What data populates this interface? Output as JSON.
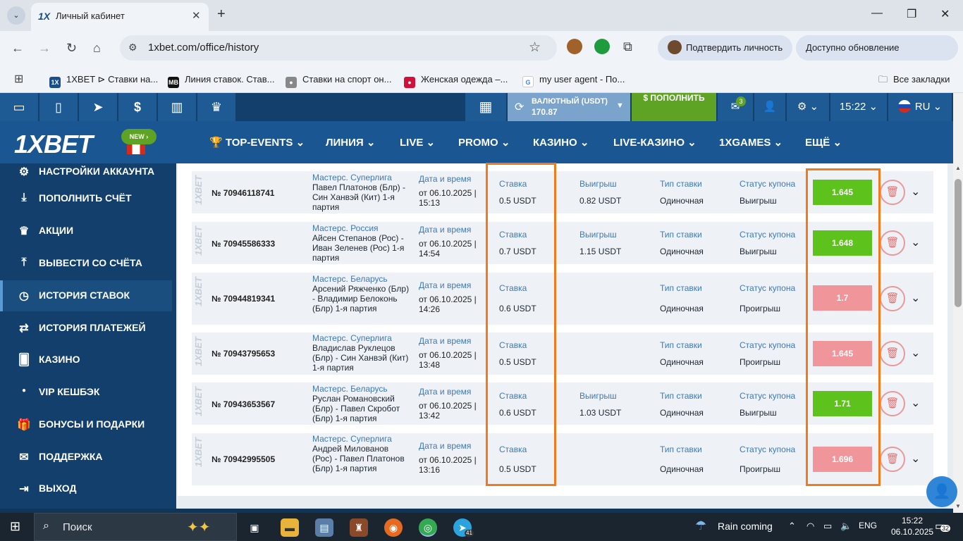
{
  "browser": {
    "tab_title": "Личный кабинет",
    "tab_favicon": "1X",
    "url": "1xbet.com/office/history",
    "profile_pill": "Подтвердить личность",
    "update_pill": "Доступно обновление Chrome",
    "bookmarks": [
      {
        "label": "1XBET ⊳ Ставки на...",
        "icon": "1X",
        "color": "#1a4f8a"
      },
      {
        "label": "Линия ставок. Став...",
        "icon": "MB",
        "color": "#111111"
      },
      {
        "label": "Ставки на спорт он...",
        "icon": "●",
        "color": "#888888"
      },
      {
        "label": "Женская одежда –...",
        "icon": "●",
        "color": "#d0103a"
      },
      {
        "label": "my user agent - По...",
        "icon": "G",
        "color": "#4285f4"
      }
    ],
    "all_bookmarks": "Все закладки"
  },
  "site": {
    "balance_label": "ВАЛЮТНЫЙ (USDT)",
    "balance_value": "170.87",
    "deposit_label": "$ ПОПОЛНИТЬ",
    "messages_badge": "3",
    "time": "15:22",
    "language": "RU",
    "logo": "1XBET",
    "new_tag": "NEW",
    "nav": [
      "TOP-EVENTS",
      "ЛИНИЯ",
      "LIVE",
      "PROMO",
      "КАЗИНО",
      "LIVE-КАЗИНО",
      "1XGAMES",
      "ЕЩЁ"
    ]
  },
  "sidebar": {
    "items": [
      {
        "label": "НАСТРОЙКИ АККАУНТА",
        "icon": "gears-icon",
        "active": false
      },
      {
        "label": "ПОПОЛНИТЬ СЧЁТ",
        "icon": "download-icon",
        "active": false
      },
      {
        "label": "АКЦИИ",
        "icon": "trophy-icon",
        "active": false
      },
      {
        "label": "ВЫВЕСТИ СО СЧЁТА",
        "icon": "upload-icon",
        "active": false
      },
      {
        "label": "ИСТОРИЯ СТАВОК",
        "icon": "clock-icon",
        "active": true
      },
      {
        "label": "ИСТОРИЯ ПЛАТЕЖЕЙ",
        "icon": "transfer-icon",
        "active": false
      },
      {
        "label": "КАЗИНО",
        "icon": "cards-icon",
        "active": false
      },
      {
        "label": "VIP КЕШБЭК",
        "icon": "dot-icon",
        "active": false
      },
      {
        "label": "БОНУСЫ И ПОДАРКИ",
        "icon": "gift-icon",
        "active": false
      },
      {
        "label": "ПОДДЕРЖКА",
        "icon": "mail-icon",
        "active": false
      },
      {
        "label": "ВЫХОД",
        "icon": "exit-icon",
        "active": false
      }
    ]
  },
  "history": {
    "labels": {
      "datetime": "Дата и время",
      "stake": "Ставка",
      "win": "Выигрыш",
      "bet_type": "Тип ставки",
      "status": "Статус купона"
    },
    "rows": [
      {
        "id": "№ 70946118741",
        "champ": "Мастерс. Суперлига",
        "event": "Павел Платонов (Блр) - Син Ханвэй (Кит) 1-я партия",
        "date": "от 06.10.2025 | 15:13",
        "stake": "0.5 USDT",
        "win": "0.82 USDT",
        "type": "Одиночная",
        "status": "Выигрыш",
        "coef": "1.645",
        "won": true
      },
      {
        "id": "№ 70945586333",
        "champ": "Мастерс. Россия",
        "event": "Айсен Степанов (Рос) - Иван Зеленев (Рос) 1-я партия",
        "date": "от 06.10.2025 | 14:54",
        "stake": "0.7 USDT",
        "win": "1.15 USDT",
        "type": "Одиночная",
        "status": "Выигрыш",
        "coef": "1.648",
        "won": true
      },
      {
        "id": "№ 70944819341",
        "champ": "Мастерс. Беларусь",
        "event": "Арсений Ряжченко (Блр) - Владимир Белоконь (Блр) 1-я партия",
        "date": "от 06.10.2025 | 14:26",
        "stake": "0.6 USDT",
        "win": "",
        "type": "Одиночная",
        "status": "Проигрыш",
        "coef": "1.7",
        "won": false
      },
      {
        "id": "№ 70943795653",
        "champ": "Мастерс. Суперлига",
        "event": "Владислав Руклецов (Блр) - Син Ханвэй (Кит) 1-я партия",
        "date": "от 06.10.2025 | 13:48",
        "stake": "0.5 USDT",
        "win": "",
        "type": "Одиночная",
        "status": "Проигрыш",
        "coef": "1.645",
        "won": false
      },
      {
        "id": "№ 70943653567",
        "champ": "Мастерс. Беларусь",
        "event": "Руслан Романовский (Блр) - Павел Скробот (Блр) 1-я партия",
        "date": "от 06.10.2025 | 13:42",
        "stake": "0.6 USDT",
        "win": "1.03 USDT",
        "type": "Одиночная",
        "status": "Выигрыш",
        "coef": "1.71",
        "won": true
      },
      {
        "id": "№ 70942995505",
        "champ": "Мастерс. Суперлига",
        "event": "Андрей Милованов (Рос) - Павел Платонов (Блр) 1-я партия",
        "date": "от 06.10.2025 | 13:16",
        "stake": "0.5 USDT",
        "win": "",
        "type": "Одиночная",
        "status": "Проигрыш",
        "coef": "1.696",
        "won": false
      }
    ]
  },
  "colors": {
    "win": "#5ec21d",
    "loss": "#f0969a",
    "highlight": "#f07a1c"
  },
  "taskbar": {
    "search": "Поиск",
    "weather": "Rain coming",
    "lang": "ENG",
    "time": "15:22",
    "date": "06.10.2025",
    "notif": "32",
    "telegram_badge": "41"
  }
}
